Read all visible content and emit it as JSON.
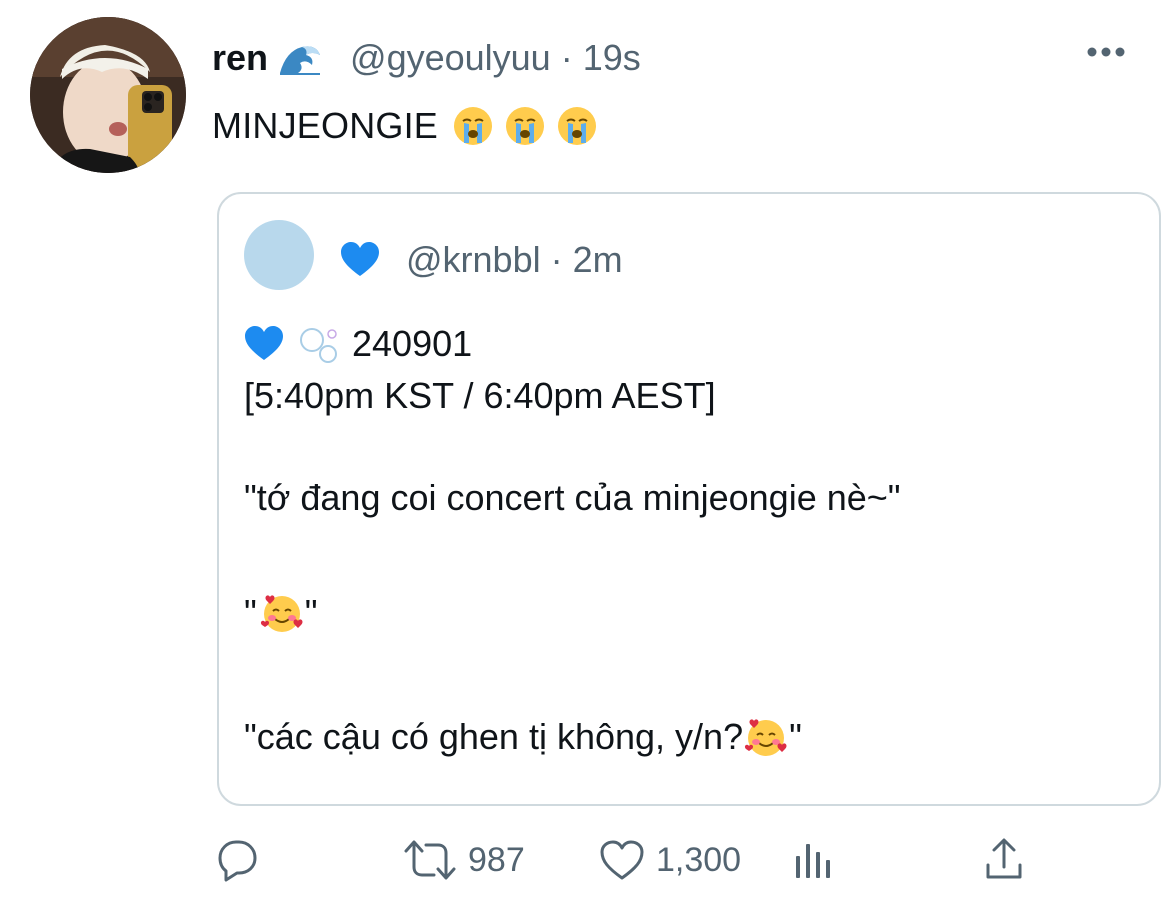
{
  "tweet": {
    "author": {
      "display_name": "ren",
      "name_emoji": "wave-icon",
      "handle": "@gyeoulyuu",
      "separator": "·",
      "time": "19s"
    },
    "text": "MINJEONGIE",
    "text_emojis": [
      "crying-face-icon",
      "crying-face-icon",
      "crying-face-icon"
    ]
  },
  "quote": {
    "author": {
      "name_emoji": "blue-heart-icon",
      "handle": "@krnbbl",
      "separator": "·",
      "time": "2m"
    },
    "lines": {
      "line1": "240901",
      "line2": "[5:40pm KST / 6:40pm AEST]",
      "line3": "\"tớ đang coi concert của minjeongie nè~\"",
      "line4_open": "\"",
      "line4_close": " \"",
      "line5_text": "\"các cậu có ghen tị không, y/n? ",
      "line5_close": " \""
    }
  },
  "actions": {
    "retweet_count": "987",
    "like_count": "1,300"
  },
  "colors": {
    "text": "#0f1419",
    "secondary": "#536471",
    "border": "#cfd9de",
    "quote_avatar": "#b8d8ec",
    "blue_heart": "#1d8bf0"
  }
}
